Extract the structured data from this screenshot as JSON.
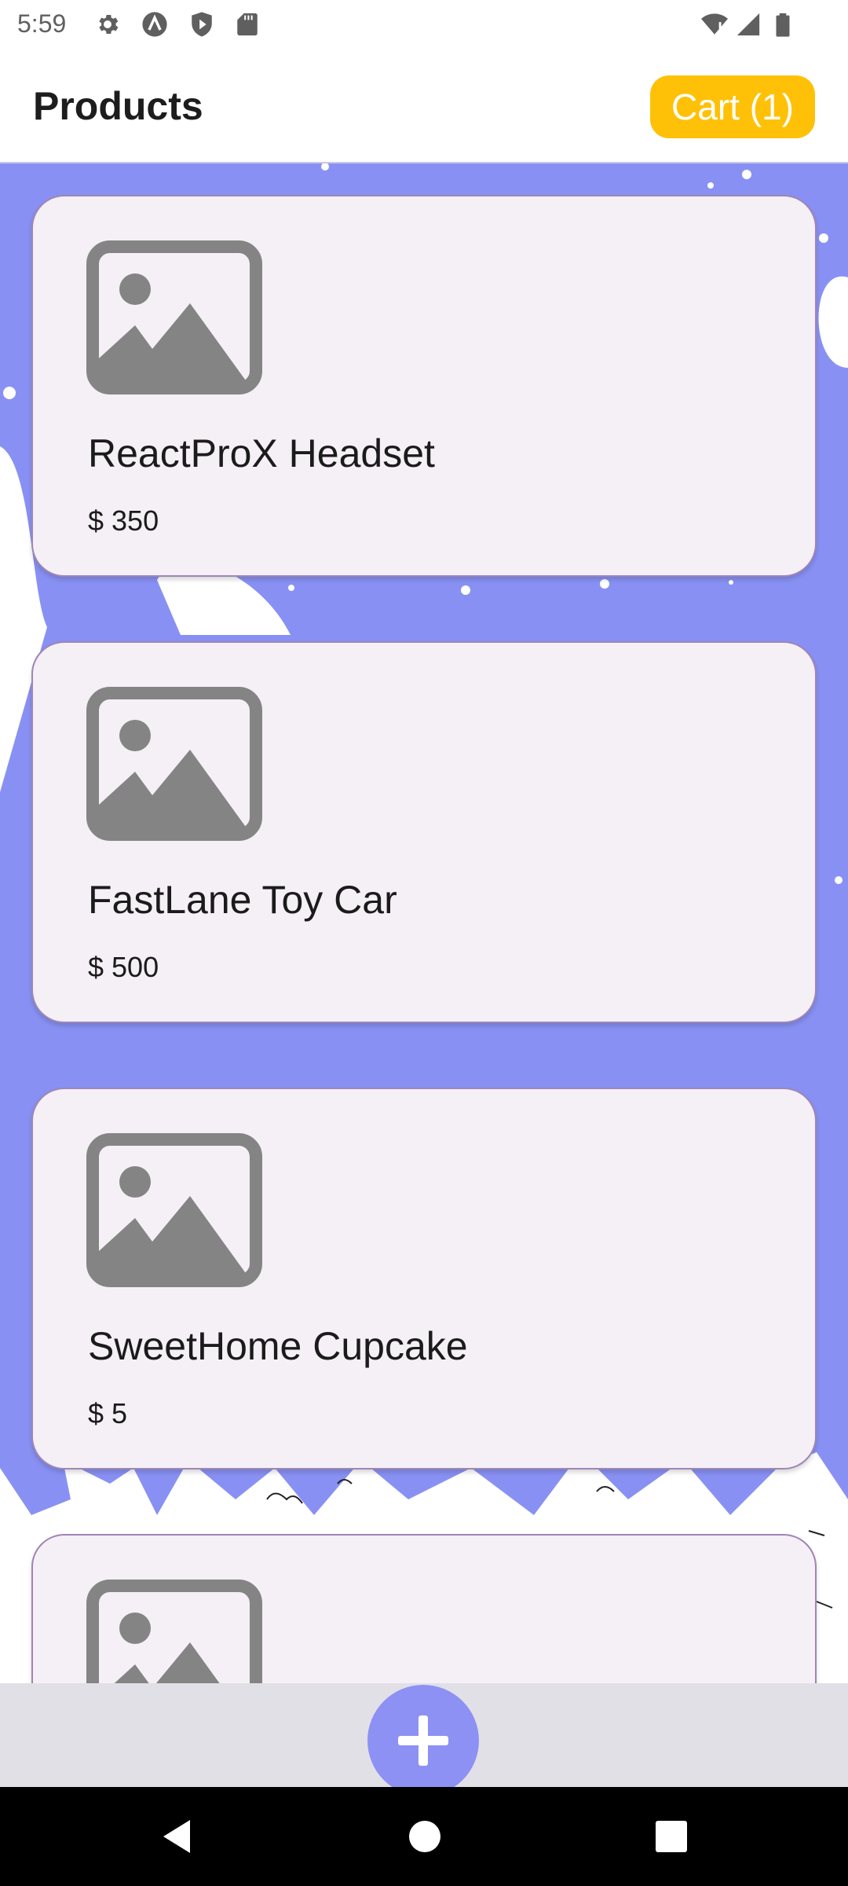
{
  "status_bar": {
    "time": "5:59",
    "left_icons": [
      "gear-icon",
      "a-icon",
      "shield-play-icon",
      "sd-card-icon"
    ],
    "right_icons": [
      "wifi-icon",
      "signal-icon",
      "battery-icon"
    ]
  },
  "header": {
    "title": "Products",
    "cart_label": "Cart (1)"
  },
  "products": [
    {
      "name": "ReactProX Headset",
      "price": "$ 350",
      "image_icon": "image-placeholder-icon"
    },
    {
      "name": "FastLane Toy Car",
      "price": "$ 500",
      "image_icon": "image-placeholder-icon"
    },
    {
      "name": "SweetHome Cupcake",
      "price": "$ 5",
      "image_icon": "image-placeholder-icon"
    },
    {
      "name": "",
      "price": "",
      "image_icon": "image-placeholder-icon"
    }
  ],
  "fab": {
    "icon": "plus-icon"
  },
  "nav": {
    "icons": [
      "back-icon",
      "home-icon",
      "recents-icon"
    ]
  },
  "colors": {
    "accent": "#ffc107",
    "background": "#8891f3",
    "card": "#f5eff6",
    "fab": "#8d91f4"
  }
}
